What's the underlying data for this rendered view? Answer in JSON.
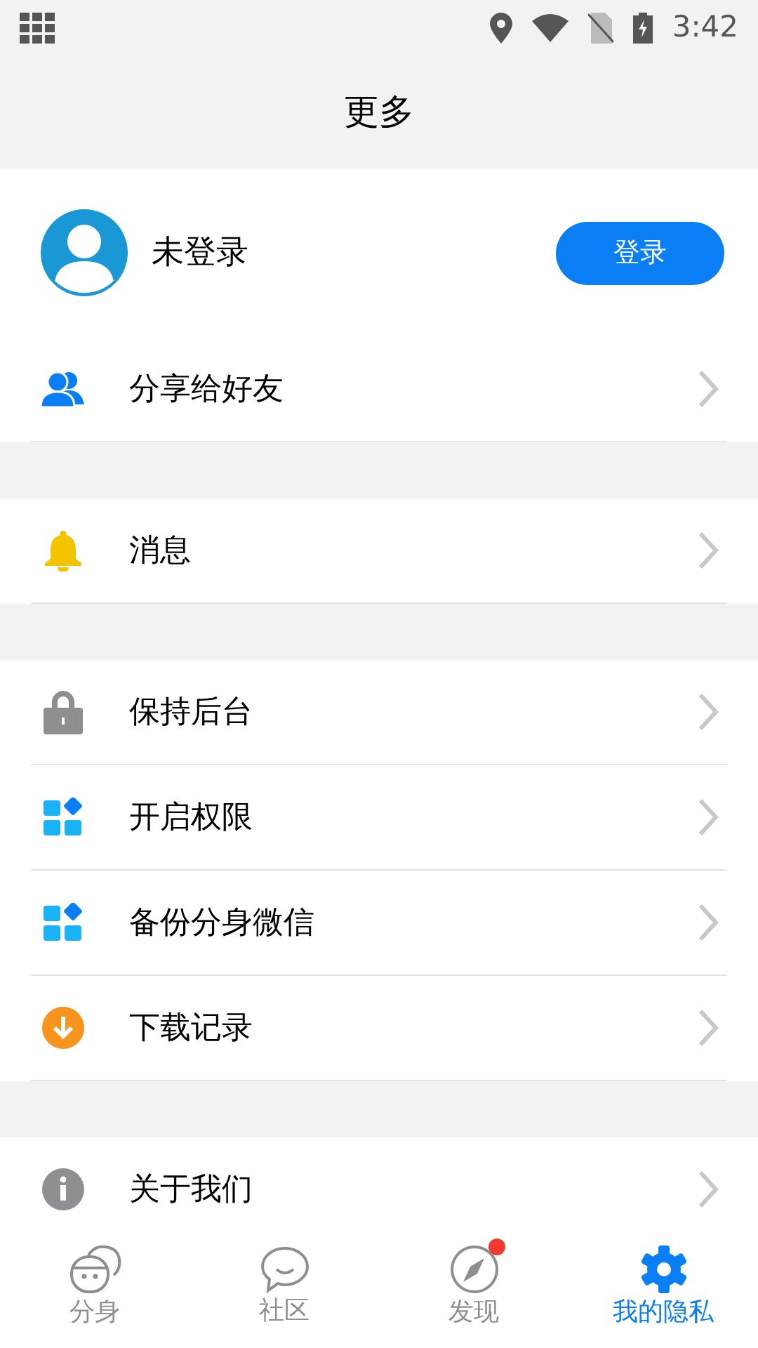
{
  "status_bar": {
    "time": "3:42"
  },
  "header": {
    "title": "更多"
  },
  "profile": {
    "name": "未登录",
    "login_button": "登录"
  },
  "groups": [
    {
      "items": [
        {
          "label": "分享给好友"
        }
      ]
    },
    {
      "items": [
        {
          "label": "消息"
        }
      ]
    },
    {
      "items": [
        {
          "label": "保持后台"
        },
        {
          "label": "开启权限"
        },
        {
          "label": "备份分身微信"
        },
        {
          "label": "下载记录"
        }
      ]
    },
    {
      "items": [
        {
          "label": "关于我们"
        }
      ]
    }
  ],
  "bottom_nav": [
    {
      "label": "分身",
      "selected": false,
      "badge": false
    },
    {
      "label": "社区",
      "selected": false,
      "badge": false
    },
    {
      "label": "发现",
      "selected": false,
      "badge": true
    },
    {
      "label": "我的隐私",
      "selected": true,
      "badge": false
    }
  ]
}
